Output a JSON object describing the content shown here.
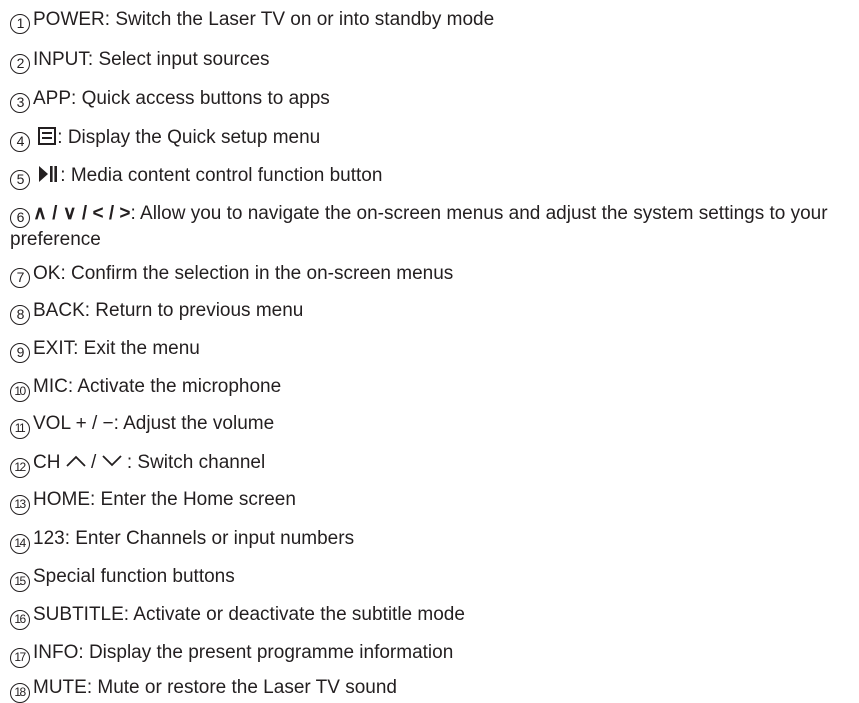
{
  "items": [
    {
      "num": "1",
      "text": "POWER: Switch the Laser TV on or into standby mode"
    },
    {
      "num": "2",
      "text": "INPUT: Select input sources"
    },
    {
      "num": "3",
      "text": "APP: Quick access buttons to apps"
    },
    {
      "num": "4",
      "icon": "quick-setup-menu-icon",
      "text": ": Display the Quick setup menu"
    },
    {
      "num": "5",
      "icon": "play-pause-icon",
      "text": ": Media content control function button"
    },
    {
      "num": "6",
      "symbols": "∧ / ∨ / < / >",
      "text": ": Allow you to navigate the on-screen menus and adjust the system settings to your preference"
    },
    {
      "num": "7",
      "text": "OK: Confirm the selection in the on-screen menus"
    },
    {
      "num": "8",
      "text": "BACK: Return to previous menu"
    },
    {
      "num": "9",
      "text": "EXIT: Exit the menu"
    },
    {
      "num": "10",
      "text": "MIC: Activate the microphone"
    },
    {
      "num": "11",
      "text": "VOL + / −: Adjust the volume"
    },
    {
      "num": "12",
      "prefix": "CH",
      "icons": [
        "chevron-up-icon",
        "chevron-down-icon"
      ],
      "text": " : Switch channel"
    },
    {
      "num": "13",
      "text": "HOME: Enter the Home screen"
    },
    {
      "num": "14",
      "text": "123: Enter Channels or input numbers"
    },
    {
      "num": "15",
      "text": "Special function buttons"
    },
    {
      "num": "16",
      "text": "SUBTITLE: Activate or deactivate the subtitle mode"
    },
    {
      "num": "17",
      "text": "INFO: Display the present programme information"
    },
    {
      "num": "18",
      "text": "MUTE: Mute or restore the Laser TV sound"
    }
  ]
}
